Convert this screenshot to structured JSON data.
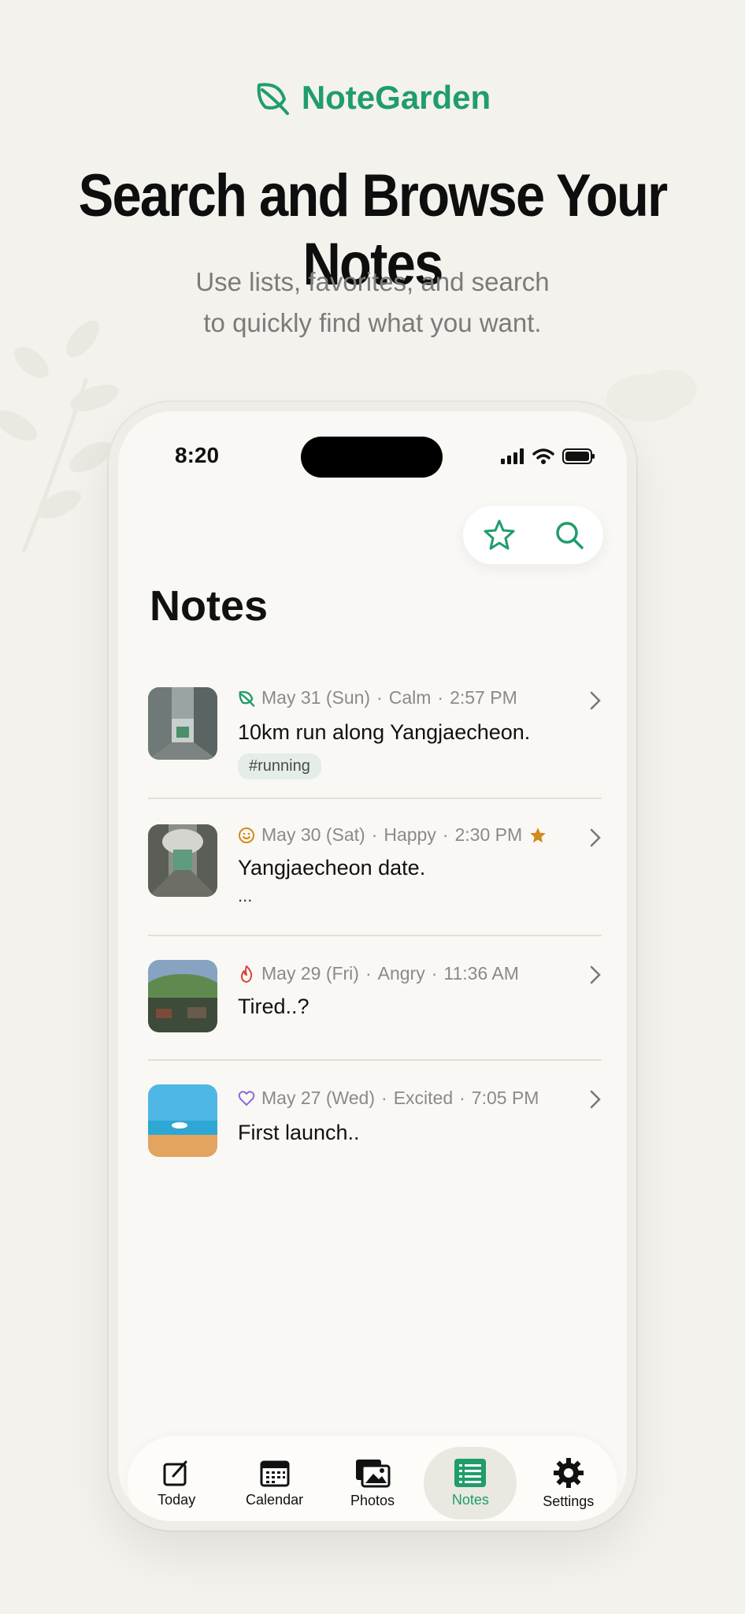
{
  "brand": {
    "name": "NoteGarden",
    "color": "#1f9d6b",
    "icon": "leaf-icon"
  },
  "headline": "Search and Browse Your Notes",
  "subhead": {
    "line1": "Use lists, favorites, and search",
    "line2": "to quickly find what you want."
  },
  "phone": {
    "status": {
      "time": "8:20"
    },
    "actions": {
      "favorites_icon": "star-icon",
      "search_icon": "search-icon"
    },
    "title": "Notes",
    "notes": [
      {
        "mood_icon": "leaf-icon",
        "date": "May 31 (Sun)",
        "mood": "Calm",
        "time": "2:57 PM",
        "text": "10km run along Yangjaecheon.",
        "tag": "#running",
        "favorite": false
      },
      {
        "mood_icon": "smile-icon",
        "date": "May 30 (Sat)",
        "mood": "Happy",
        "time": "2:30 PM",
        "text": "Yangjaecheon date.",
        "extra": "...",
        "favorite": true
      },
      {
        "mood_icon": "flame-icon",
        "date": "May 29 (Fri)",
        "mood": "Angry",
        "time": "11:36 AM",
        "text": "Tired..?",
        "favorite": false
      },
      {
        "mood_icon": "heart-icon",
        "date": "May 27 (Wed)",
        "mood": "Excited",
        "time": "7:05 PM",
        "text": "First launch..",
        "favorite": false
      }
    ],
    "tabs": [
      {
        "label": "Today",
        "icon": "compose-icon"
      },
      {
        "label": "Calendar",
        "icon": "calendar-icon"
      },
      {
        "label": "Photos",
        "icon": "photos-icon"
      },
      {
        "label": "Notes",
        "icon": "notes-icon",
        "active": true
      },
      {
        "label": "Settings",
        "icon": "gear-icon"
      }
    ]
  }
}
